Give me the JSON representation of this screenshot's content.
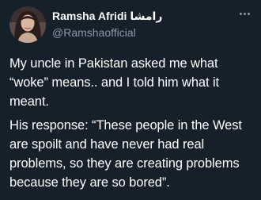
{
  "tweet": {
    "author": {
      "display_name": "Ramsha Afridi",
      "display_name_urdu": "رامشا",
      "handle": "@Ramshaofficial",
      "avatar": "profile-photo"
    },
    "more_icon": "more-horizontal-icon",
    "paragraphs": [
      "My uncle in Pakistan asked me what “woke” means.. and I told him what it meant.",
      "His response: “These people in the West are spoilt and have never had real problems, so they are creating problems because they are so bored”."
    ]
  },
  "colors": {
    "background": "#15202b",
    "text_primary": "#ffffff",
    "text_secondary": "#8899a6"
  }
}
